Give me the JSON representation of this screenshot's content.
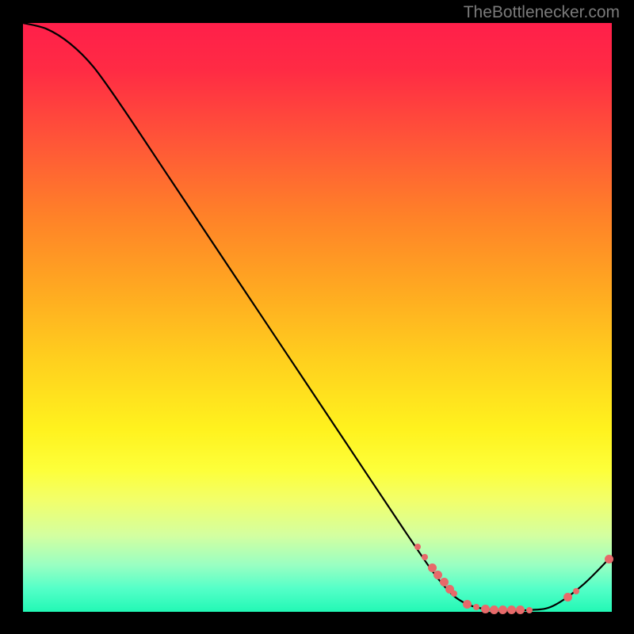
{
  "watermark": "TheBottlenecker.com",
  "colors": {
    "page_bg": "#000000",
    "gradient_top": "#ff1f4a",
    "gradient_bottom": "#22f8b5",
    "curve": "#000000",
    "dot": "#e76a6a",
    "watermark": "#7a7a7a"
  },
  "chart_data": {
    "type": "line",
    "title": "",
    "xlabel": "",
    "ylabel": "",
    "xlim": [
      0,
      100
    ],
    "ylim": [
      0,
      100
    ],
    "grid": false,
    "curve": [
      {
        "x": 0,
        "y": 100
      },
      {
        "x": 4,
        "y": 99
      },
      {
        "x": 8,
        "y": 96.5
      },
      {
        "x": 12,
        "y": 92.5
      },
      {
        "x": 17,
        "y": 85.5
      },
      {
        "x": 25,
        "y": 73.5
      },
      {
        "x": 35,
        "y": 58.5
      },
      {
        "x": 45,
        "y": 43.5
      },
      {
        "x": 55,
        "y": 28.5
      },
      {
        "x": 65,
        "y": 13.5
      },
      {
        "x": 71,
        "y": 5
      },
      {
        "x": 75,
        "y": 1.5
      },
      {
        "x": 80,
        "y": 0.3
      },
      {
        "x": 86,
        "y": 0.3
      },
      {
        "x": 90,
        "y": 1
      },
      {
        "x": 95,
        "y": 4.5
      },
      {
        "x": 100,
        "y": 9.5
      }
    ],
    "dots": [
      {
        "x": 67,
        "y": 11.0,
        "size": "small"
      },
      {
        "x": 68.2,
        "y": 9.3,
        "size": "small"
      },
      {
        "x": 69.5,
        "y": 7.5,
        "size": "normal"
      },
      {
        "x": 70.5,
        "y": 6.2,
        "size": "normal"
      },
      {
        "x": 71.5,
        "y": 5.0,
        "size": "normal"
      },
      {
        "x": 72.5,
        "y": 3.9,
        "size": "normal"
      },
      {
        "x": 73.2,
        "y": 3.1,
        "size": "small"
      },
      {
        "x": 75.5,
        "y": 1.3,
        "size": "normal"
      },
      {
        "x": 77.0,
        "y": 0.8,
        "size": "small"
      },
      {
        "x": 78.5,
        "y": 0.5,
        "size": "normal"
      },
      {
        "x": 80.0,
        "y": 0.4,
        "size": "normal"
      },
      {
        "x": 81.5,
        "y": 0.3,
        "size": "normal"
      },
      {
        "x": 83.0,
        "y": 0.3,
        "size": "normal"
      },
      {
        "x": 84.5,
        "y": 0.3,
        "size": "normal"
      },
      {
        "x": 86.0,
        "y": 0.3,
        "size": "small"
      },
      {
        "x": 92.5,
        "y": 2.5,
        "size": "normal"
      },
      {
        "x": 93.9,
        "y": 3.5,
        "size": "small"
      },
      {
        "x": 99.5,
        "y": 9.0,
        "size": "normal"
      }
    ]
  }
}
